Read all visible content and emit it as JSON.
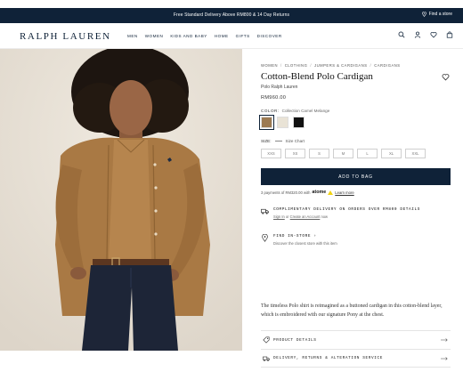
{
  "promo": {
    "text": "Free Standard Delivery Above RM800 & 14 Day Returns",
    "store_link": "Find a store"
  },
  "header": {
    "brand": "RALPH LAUREN",
    "nav": [
      "MEN",
      "WOMEN",
      "KIDS AND BABY",
      "HOME",
      "GIFTS",
      "DISCOVER"
    ],
    "icons": [
      "search-icon",
      "account-icon",
      "wishlist-icon",
      "bag-icon"
    ]
  },
  "breadcrumb": [
    "WOMEN",
    "CLOTHING",
    "JUMPERS & CARDIGANS",
    "CARDIGANS"
  ],
  "product": {
    "title": "Cotton-Blend Polo Cardigan",
    "brand": "Polo Ralph Lauren",
    "price": "RM960.00",
    "color_label": "COLOR:",
    "color_value": "Collection Camel Melange",
    "swatches": [
      {
        "name": "Collection Camel Melange",
        "color": "#9c7a52",
        "selected": true
      },
      {
        "name": "Cream",
        "color": "#e9e3d6",
        "selected": false
      },
      {
        "name": "Black",
        "color": "#111111",
        "selected": false
      }
    ],
    "size_label": "SIZE:",
    "size_chart": "Size Chart",
    "sizes": [
      "XXS",
      "XS",
      "S",
      "M",
      "L",
      "XL",
      "XXL"
    ],
    "add_to_bag": "ADD TO BAG",
    "installment_prefix": "3 payments of RM320.00 with",
    "installment_brand": "atome",
    "learn_more": "Learn more",
    "accent_color": "#0f2238"
  },
  "delivery": {
    "title": "COMPLIMENTARY DELIVERY ON ORDERS OVER RM800 DETAILS",
    "sign_in": "Sign In",
    "or_text": "or",
    "create": "Create an Account",
    "now": "now"
  },
  "store": {
    "title": "FIND IN-STORE",
    "chevron": "›",
    "subtitle": "Discover the closest store with this item"
  },
  "description": {
    "line1": "The timeless Polo shirt is reimagined as a buttoned cardigan in this cotton-blend layer,",
    "line2": "which is embroidered with our signature Pony at the chest."
  },
  "accordions": [
    {
      "label": "PRODUCT DETAILS",
      "icon": "tag-icon"
    },
    {
      "label": "DELIVERY, RETURNS & ALTERATION SERVICE",
      "icon": "truck-icon"
    }
  ]
}
